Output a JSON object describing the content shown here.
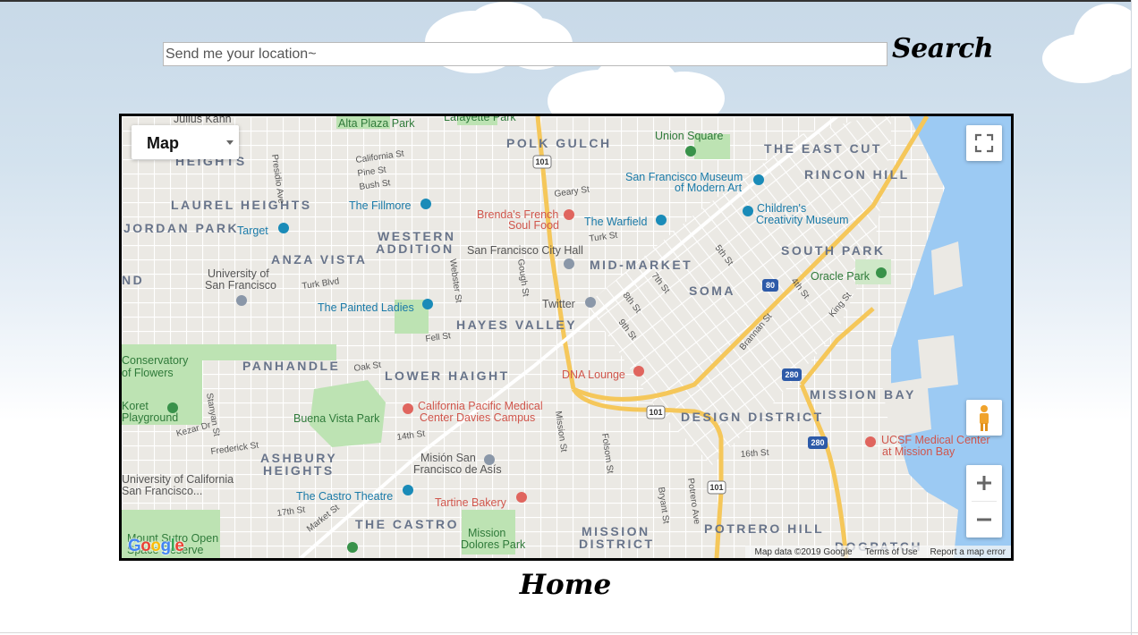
{
  "search": {
    "placeholder": "Send me your location~",
    "button_label": "Search"
  },
  "map": {
    "type_control": {
      "label": "Map"
    },
    "attribution": {
      "map_data": "Map data ©2019 Google",
      "terms": "Terms of Use",
      "report": "Report a map error"
    },
    "logo": "Google",
    "neighborhoods": [
      "POLK GULCH",
      "THE EAST CUT",
      "RINCON HILL",
      "LAUREL HEIGHTS",
      "JORDAN PARK",
      "WESTERN",
      "ADDITION",
      "ANZA VISTA",
      "MID-MARKET",
      "SOUTH PARK",
      "SOMA",
      "HAYES VALLEY",
      "PANHANDLE",
      "LOWER HAIGHT",
      "MISSION BAY",
      "DESIGN DISTRICT",
      "ASHBURY",
      "HEIGHTS",
      "THE CASTRO",
      "MISSION",
      "DISTRICT",
      "POTRERO HILL",
      "DOGPATCH",
      "HEIGHTS",
      "ND"
    ],
    "places": [
      "Julius Kahn",
      "Alta Plaza Park",
      "Lafayette Park",
      "Union Square",
      "San Francisco Museum",
      "of Modern Art",
      "Children's",
      "Creativity Museum",
      "The Fillmore",
      "Brenda's French",
      "Soul Food",
      "The Warfield",
      "Target",
      "San Francisco City Hall",
      "University of",
      "San Francisco",
      "Oracle Park",
      "The Painted Ladies",
      "Twitter",
      "DNA Lounge",
      "Conservatory",
      "of Flowers",
      "Koret",
      "Playground",
      "California Pacific Medical",
      "Center Davies Campus",
      "Buena Vista Park",
      "UCSF Medical Center",
      "at Mission Bay",
      "Misión San",
      "Francisco de Asís",
      "University of California",
      "San Francisco...",
      "The Castro Theatre",
      "Tartine Bakery",
      "Mission",
      "Dolores Park",
      "Mount Sutro Open",
      "Space Reserve"
    ],
    "streets": [
      "California St",
      "Pine St",
      "Bush St",
      "Geary St",
      "Turk St",
      "Turk Blvd",
      "Fell St",
      "Oak St",
      "Stanyan St",
      "Frederick St",
      "Kezar Dr",
      "14th St",
      "17th St",
      "16th St",
      "Market St",
      "Webster St",
      "Gough St",
      "Mission St",
      "Folsom St",
      "Bryant St",
      "Potrero Ave",
      "8th St",
      "9th St",
      "7th St",
      "5th St",
      "4th St",
      "Brannan St",
      "King St",
      "Presidio Ave"
    ],
    "highways": [
      "101",
      "80",
      "280"
    ]
  },
  "footer": {
    "title": "Home"
  },
  "colors": {
    "sky": "#cfdeeb",
    "water": "#9ccaf3",
    "park": "#bde3b3",
    "land": "#ebe9e4",
    "highway": "#f5c75a",
    "district_label": "#68748a",
    "poi_blue": "#1a8bb8",
    "poi_red": "#e0655e",
    "poi_green": "#39924a"
  }
}
